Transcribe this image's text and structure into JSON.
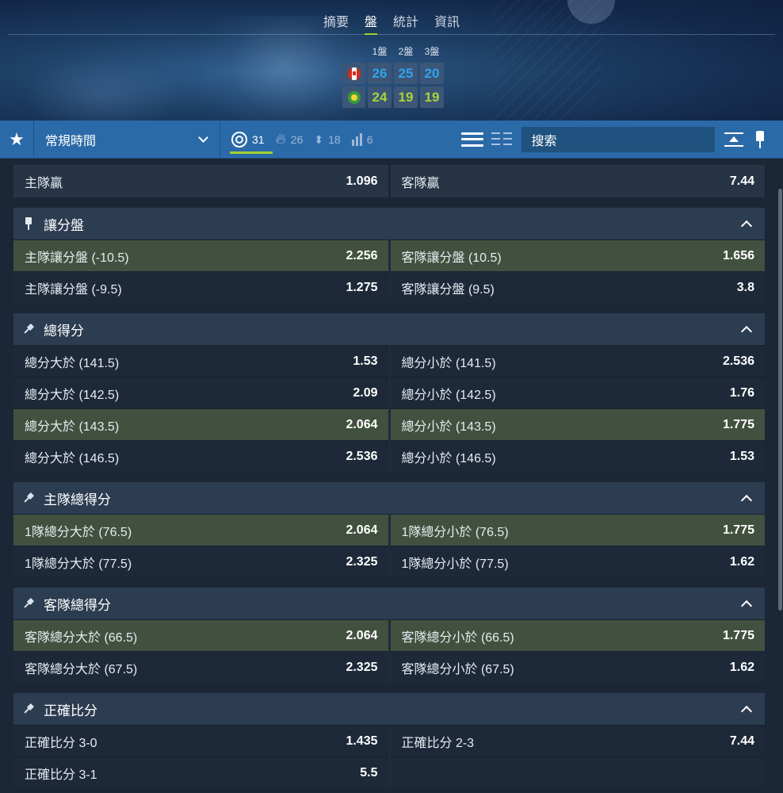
{
  "tabs": [
    "摘要",
    "盤",
    "統計",
    "資訊"
  ],
  "active_tab_index": 1,
  "scoreboard": {
    "set_labels": [
      "1盤",
      "2盤",
      "3盤"
    ],
    "home": {
      "flag": "canada-flag-icon",
      "scores": [
        "26",
        "25",
        "20"
      ],
      "color": "#2fa3f0"
    },
    "away": {
      "flag": "brazil-flag-icon",
      "scores": [
        "24",
        "19",
        "19"
      ],
      "color": "#a8d33a"
    }
  },
  "toolbar": {
    "period": "常規時間",
    "filters": [
      {
        "icon": "target-icon",
        "count": "31",
        "active": true
      },
      {
        "icon": "flame-icon",
        "count": "26",
        "active": false
      },
      {
        "icon": "sort-arrows-icon",
        "count": "18",
        "active": false
      },
      {
        "icon": "bar-chart-icon",
        "count": "6",
        "active": false
      }
    ],
    "search_placeholder": "搜索"
  },
  "winner": {
    "home": {
      "label": "主隊贏",
      "odds": "1.096"
    },
    "away": {
      "label": "客隊贏",
      "odds": "7.44"
    }
  },
  "markets": [
    {
      "title": "讓分盤",
      "pinned": true,
      "rows": [
        {
          "highlight": true,
          "left": {
            "label": "主隊讓分盤 (-10.5)",
            "odds": "2.256"
          },
          "right": {
            "label": "客隊讓分盤 (10.5)",
            "odds": "1.656"
          }
        },
        {
          "highlight": false,
          "left": {
            "label": "主隊讓分盤 (-9.5)",
            "odds": "1.275"
          },
          "right": {
            "label": "客隊讓分盤 (9.5)",
            "odds": "3.8"
          }
        }
      ]
    },
    {
      "title": "總得分",
      "pinned": false,
      "rows": [
        {
          "highlight": false,
          "left": {
            "label": "總分大於 (141.5)",
            "odds": "1.53"
          },
          "right": {
            "label": "總分小於 (141.5)",
            "odds": "2.536"
          }
        },
        {
          "highlight": false,
          "left": {
            "label": "總分大於 (142.5)",
            "odds": "2.09"
          },
          "right": {
            "label": "總分小於 (142.5)",
            "odds": "1.76"
          }
        },
        {
          "highlight": true,
          "left": {
            "label": "總分大於 (143.5)",
            "odds": "2.064"
          },
          "right": {
            "label": "總分小於 (143.5)",
            "odds": "1.775"
          }
        },
        {
          "highlight": false,
          "left": {
            "label": "總分大於 (146.5)",
            "odds": "2.536"
          },
          "right": {
            "label": "總分小於 (146.5)",
            "odds": "1.53"
          }
        }
      ]
    },
    {
      "title": "主隊總得分",
      "pinned": false,
      "rows": [
        {
          "highlight": true,
          "left": {
            "label": "1隊總分大於 (76.5)",
            "odds": "2.064"
          },
          "right": {
            "label": "1隊總分小於 (76.5)",
            "odds": "1.775"
          }
        },
        {
          "highlight": false,
          "left": {
            "label": "1隊總分大於 (77.5)",
            "odds": "2.325"
          },
          "right": {
            "label": "1隊總分小於 (77.5)",
            "odds": "1.62"
          }
        }
      ]
    },
    {
      "title": "客隊總得分",
      "pinned": false,
      "rows": [
        {
          "highlight": true,
          "left": {
            "label": "客隊總分大於 (66.5)",
            "odds": "2.064"
          },
          "right": {
            "label": "客隊總分小於 (66.5)",
            "odds": "1.775"
          }
        },
        {
          "highlight": false,
          "left": {
            "label": "客隊總分大於 (67.5)",
            "odds": "2.325"
          },
          "right": {
            "label": "客隊總分小於 (67.5)",
            "odds": "1.62"
          }
        }
      ]
    },
    {
      "title": "正確比分",
      "pinned": false,
      "rows": [
        {
          "highlight": false,
          "left": {
            "label": "正確比分 3-0",
            "odds": "1.435"
          },
          "right": {
            "label": "正確比分 2-3",
            "odds": "7.44"
          }
        },
        {
          "highlight": false,
          "left": {
            "label": "正確比分 3-1",
            "odds": "5.5"
          },
          "right": null
        }
      ]
    }
  ],
  "colors": {
    "toolbar": "#2b6aa8",
    "highlight_row": "#42513f",
    "active_underline": "#9fcf2d"
  }
}
